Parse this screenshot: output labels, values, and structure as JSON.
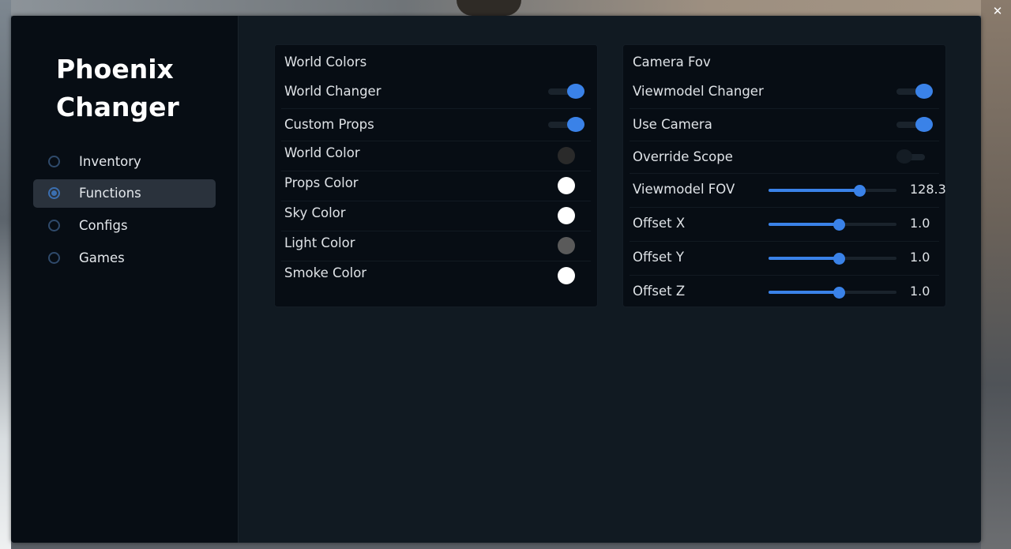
{
  "app": {
    "title_line1": "Phoenix",
    "title_line2": "Changer"
  },
  "window": {
    "close_icon": "✕"
  },
  "sidebar": {
    "items": [
      {
        "label": "Inventory",
        "active": false
      },
      {
        "label": "Functions",
        "active": true
      },
      {
        "label": "Configs",
        "active": false
      },
      {
        "label": "Games",
        "active": false
      }
    ]
  },
  "world_panel": {
    "title": "World Colors",
    "toggles": [
      {
        "label": "World Changer",
        "on": true
      },
      {
        "label": "Custom Props",
        "on": true
      }
    ],
    "colors": [
      {
        "label": "World Color",
        "color": "#2a2a2a"
      },
      {
        "label": "Props Color",
        "color": "#ffffff"
      },
      {
        "label": "Sky Color",
        "color": "#ffffff"
      },
      {
        "label": "Light Color",
        "color": "#5a5a5a"
      },
      {
        "label": "Smoke Color",
        "color": "#ffffff"
      }
    ]
  },
  "camera_panel": {
    "title": "Camera Fov",
    "toggles": [
      {
        "label": "Viewmodel Changer",
        "on": true
      },
      {
        "label": "Use Camera",
        "on": true
      },
      {
        "label": "Override Scope",
        "on": false
      }
    ],
    "sliders": [
      {
        "label": "Viewmodel FOV",
        "value": "128.3",
        "fraction": 0.71
      },
      {
        "label": "Offset X",
        "value": "1.0",
        "fraction": 0.55
      },
      {
        "label": "Offset Y",
        "value": "1.0",
        "fraction": 0.55
      },
      {
        "label": "Offset Z",
        "value": "1.0",
        "fraction": 0.55
      }
    ]
  },
  "colors": {
    "accent": "#3a82e8",
    "panel": "#070d14",
    "window": "#111a22"
  }
}
